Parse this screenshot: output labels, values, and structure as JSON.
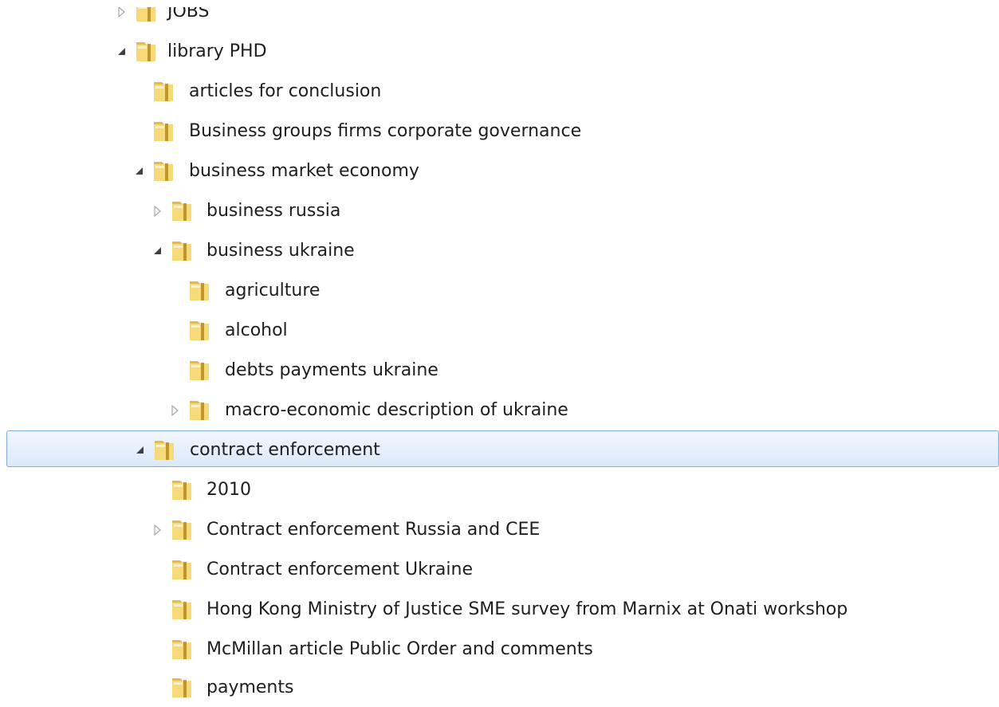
{
  "tree": {
    "nodes": [
      {
        "label": "JOBS",
        "state": "collapsed",
        "icon": "folder-icon"
      },
      {
        "label": "library PHD",
        "state": "expanded",
        "icon": "folder-icon"
      },
      {
        "label": "articles for conclusion",
        "state": "leaf",
        "icon": "folder-icon"
      },
      {
        "label": "Business groups firms corporate governance",
        "state": "leaf",
        "icon": "folder-icon"
      },
      {
        "label": "business market economy",
        "state": "expanded",
        "icon": "folder-icon"
      },
      {
        "label": "business russia",
        "state": "collapsed",
        "icon": "folder-icon"
      },
      {
        "label": "business ukraine",
        "state": "expanded",
        "icon": "folder-icon"
      },
      {
        "label": "agriculture",
        "state": "leaf",
        "icon": "folder-icon"
      },
      {
        "label": "alcohol",
        "state": "leaf",
        "icon": "folder-icon"
      },
      {
        "label": "debts payments ukraine",
        "state": "leaf",
        "icon": "folder-icon"
      },
      {
        "label": "macro-economic description of ukraine",
        "state": "collapsed",
        "icon": "folder-icon"
      },
      {
        "label": "contract enforcement",
        "state": "expanded",
        "icon": "folder-icon",
        "selected": true
      },
      {
        "label": "2010",
        "state": "leaf",
        "icon": "folder-icon"
      },
      {
        "label": "Contract enforcement Russia and CEE",
        "state": "collapsed",
        "icon": "folder-icon"
      },
      {
        "label": "Contract enforcement Ukraine",
        "state": "leaf",
        "icon": "folder-icon"
      },
      {
        "label": "Hong Kong Ministry of Justice SME survey from Marnix at Onati workshop",
        "state": "leaf",
        "icon": "folder-icon"
      },
      {
        "label": "McMillan article Public Order and comments",
        "state": "leaf",
        "icon": "folder-icon"
      },
      {
        "label": "payments",
        "state": "leaf",
        "icon": "folder-icon"
      }
    ]
  },
  "colors": {
    "selection_fill_top": "#f2f7fe",
    "selection_fill_bottom": "#dbe8fa",
    "selection_border": "#84acdd",
    "folder_yellow": "#f1cf63",
    "text": "#1e1e1e"
  }
}
